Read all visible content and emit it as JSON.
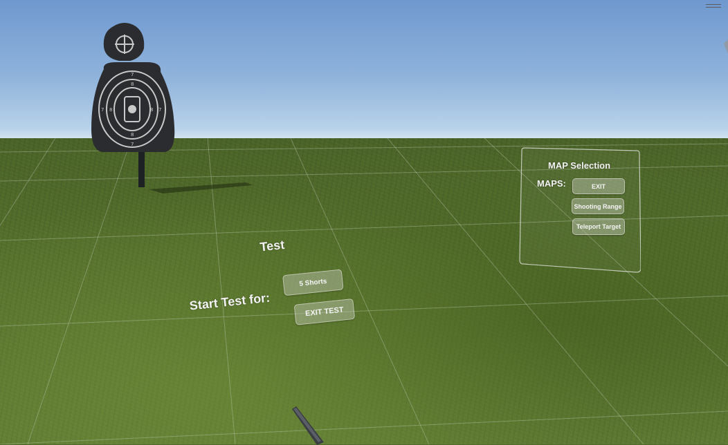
{
  "test_panel": {
    "title": "Test",
    "start_label": "Start Test for:",
    "shots_button": "5 Shorts",
    "exit_button": "EXIT TEST"
  },
  "map_panel": {
    "title": "MAP Selection",
    "maps_label": "MAPS:",
    "buttons": [
      "EXIT",
      "Shooting Range",
      "Teleport Target"
    ]
  },
  "icons": {
    "menu": "hamburger-icon",
    "target": "shooting-target-icon",
    "controller": "vr-controller-pointer"
  },
  "colors": {
    "sky_top": "#6f98cf",
    "horizon": "#d7e5ef",
    "grass": "#55702c",
    "ui_text": "#f2f2f2",
    "button_fill": "#c8cdbe"
  }
}
